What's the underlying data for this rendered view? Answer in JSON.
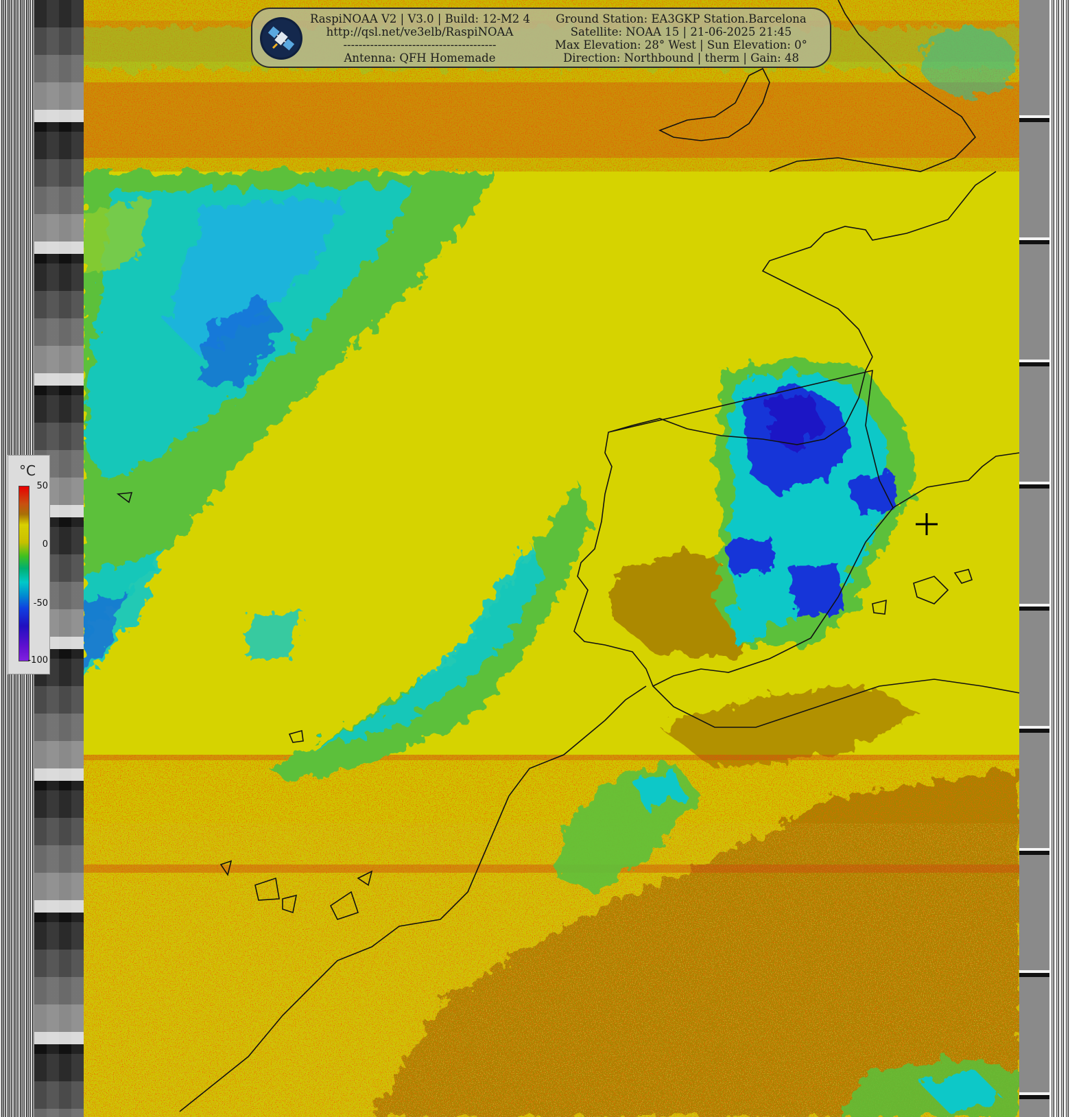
{
  "header": {
    "lines_left": [
      "RaspiNOAA V2 | V3.0 | Build: 12-M2 4",
      "http://qsl.net/ve3elb/RaspiNOAA",
      "----------------------------------------",
      "Antenna: QFH Homemade"
    ],
    "lines_right": [
      "Ground Station: EA3GKP Station.Barcelona",
      "Satellite: NOAA 15 | 21-06-2025 21:45",
      "Max Elevation: 28° West | Sun Elevation: 0°",
      "Direction: Northbound | therm | Gain: 48"
    ],
    "logo_icon": "satellite-icon"
  },
  "legend": {
    "unit": "°C",
    "ticks": [
      "50",
      "0",
      "-50",
      "-100"
    ]
  },
  "colors": {
    "warm_ground": "#d6d300",
    "hot": "#e02000",
    "brown": "#a57b07",
    "cool_green": "#5cc03a",
    "cold_cyan": "#10c8c8",
    "very_cold_blue": "#1636d8"
  },
  "map": {
    "station_marker_icon": "crosshair-icon"
  }
}
